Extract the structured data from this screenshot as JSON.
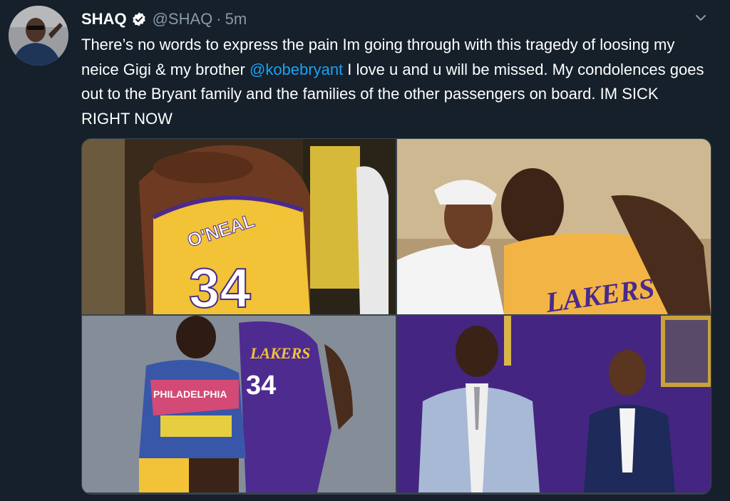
{
  "tweet": {
    "author_name": "SHAQ",
    "handle": "@SHAQ",
    "separator": "·",
    "time": "5m",
    "text_before_mention": "There’s no words to express the pain Im going through with this tragedy of loosing my neice Gigi & my brother ",
    "mention": "@kobebryant",
    "text_after_mention": " I love u and u will be missed. My condolences goes out to the Bryant family and the families of the other passengers on board. IM SICK RIGHT NOW",
    "verified": true
  },
  "media": {
    "photos": [
      {
        "jersey_name": "O'NEAL",
        "jersey_number": "34"
      },
      {
        "jersey_text": "LAKERS"
      },
      {
        "jersey_text": "LAKERS",
        "jersey_number": "34",
        "jacket_text": "PHILADELPHIA"
      },
      {}
    ]
  },
  "colors": {
    "background": "#15202b",
    "text": "#ffffff",
    "secondary_text": "#8899a6",
    "link": "#1da1f2",
    "lakers_gold": "#f2c237",
    "lakers_purple": "#4a2a8c"
  }
}
